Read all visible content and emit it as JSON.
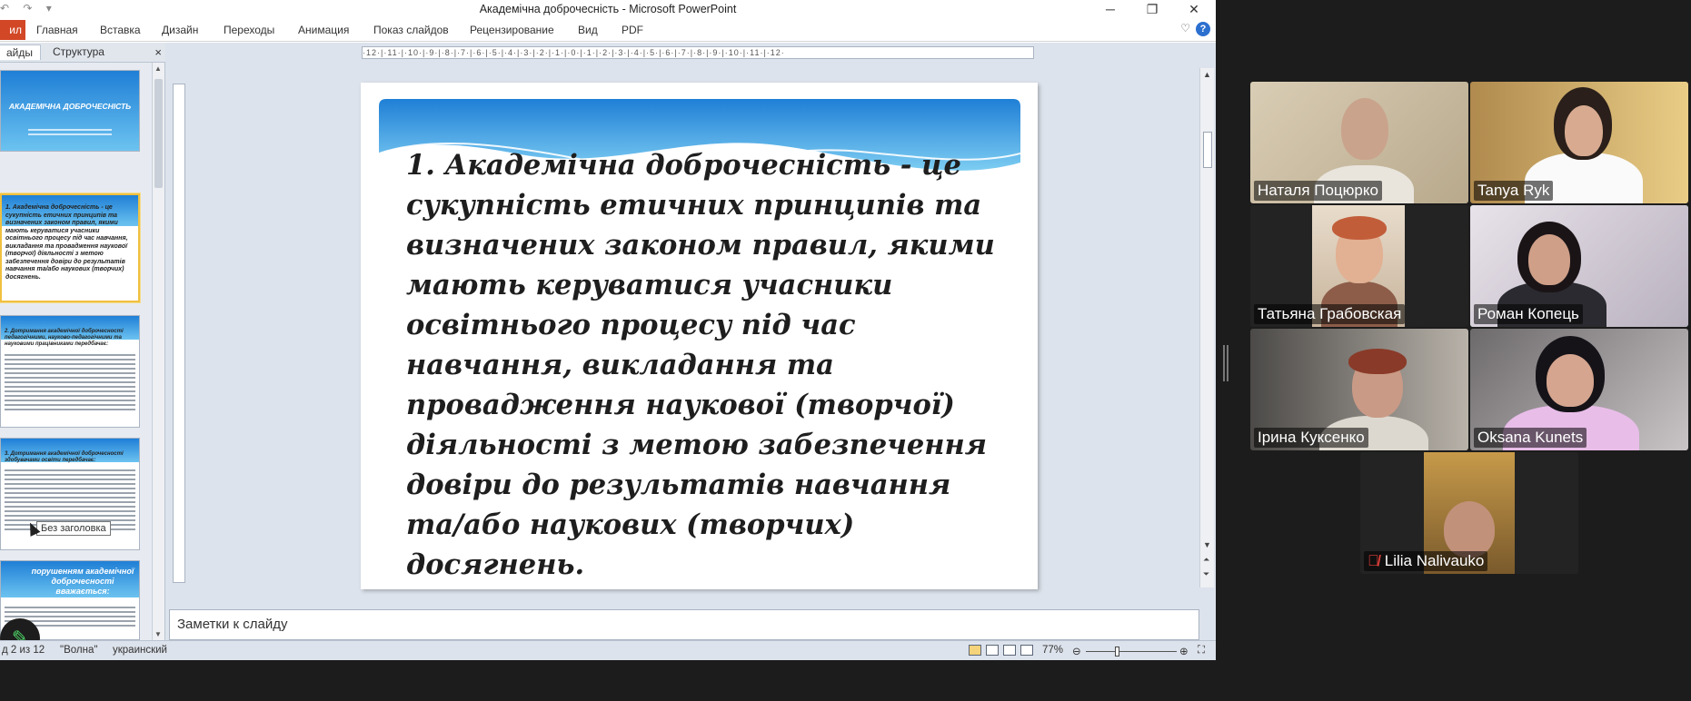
{
  "window": {
    "title": "Академічна доброчесність  -  Microsoft PowerPoint",
    "qat": "↶ ↷ ▾"
  },
  "ribbon": {
    "file_tab": "ил",
    "tabs": [
      "Главная",
      "Вставка",
      "Дизайн",
      "Переходы",
      "Анимация",
      "Показ слайдов",
      "Рецензирование",
      "Вид",
      "PDF"
    ]
  },
  "panel": {
    "tab_slides": "айды",
    "tab_outline": "Структура",
    "close": "×",
    "thumb1_title": "АКАДЕМІЧНА ДОБРОЧЕСНІСТЬ",
    "thumb2_text": "1. Академічна доброчесність - це сукупність етичних принципів та визначених законом правил, якими мають керуватися учасники освітнього процесу під час навчання, викладання та провадження наукової (творчої) діяльності з метою забезпечення довіри до результатів навчання та/або наукових (творчих) досягнень.",
    "thumb3_text": "2. Дотримання академічної доброчесності педагогічними, науково-педагогічними та науковими працівниками передбачає:",
    "thumb4_text": "3. Дотримання академічної доброчесності здобувачами освіти передбачає:",
    "thumb5_text": "порушенням академічної доброчесності вважається:",
    "tooltip": "Без заголовка"
  },
  "ruler_top": "·12·|·11·|·10·|·9·|·8·|·7·|·6·|·5·|·4·|·3·|·2·|·1·|·0·|·1·|·2·|·3·|·4·|·5·|·6·|·7·|·8·|·9·|·10·|·11·|·12·",
  "slide": {
    "body": "1. Академічна доброчесність - це сукупність етичних принципів та визначених законом правил, якими мають керуватися учасники освітнього процесу під час навчання, викладання та провадження наукової (творчої) діяльності з метою забезпечення довіри до результатів навчання та/або наукових (творчих) досягнень."
  },
  "notes": {
    "placeholder": "Заметки к слайду"
  },
  "status": {
    "slide_count": "д 2 из 12",
    "theme": "\"Волна\"",
    "language": "украинский",
    "zoom": "77%"
  },
  "meeting": {
    "participants": [
      {
        "name": "Наталя Поцюрко",
        "muted": false,
        "active": false
      },
      {
        "name": "Tanya Ryk",
        "muted": false,
        "active": false
      },
      {
        "name": "Татьяна Грабовская",
        "muted": false,
        "active": false
      },
      {
        "name": "Роман Копець",
        "muted": false,
        "active": true
      },
      {
        "name": "Ірина Куксенко",
        "muted": false,
        "active": false
      },
      {
        "name": "Oksana Kunets",
        "muted": false,
        "active": false
      },
      {
        "name": "Lilia Nalivauko",
        "muted": true,
        "active": false
      }
    ],
    "active_color": "#23d96b",
    "muted_color": "#e0413b"
  },
  "colors": {
    "wave_dark": "#1f7fd6",
    "wave_light": "#6cc3f0",
    "file_tab": "#d24726"
  }
}
